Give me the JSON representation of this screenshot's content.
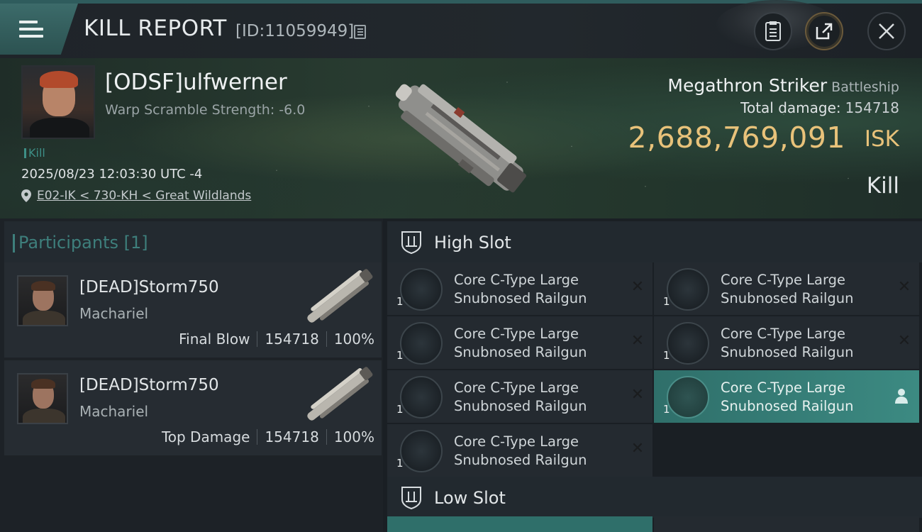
{
  "header": {
    "title": "KILL REPORT",
    "report_id": "[ID:11059949]"
  },
  "victim": {
    "name": "[ODSF]ulfwerner",
    "warp_scramble": "Warp Scramble Strength: -6.0",
    "tag": "Kill",
    "timestamp": "2025/08/23 12:03:30 UTC -4",
    "location": "E02-IK < 730-KH < Great Wildlands",
    "ship_name": "Megathron Striker",
    "ship_class": "Battleship",
    "total_damage_label": "Total damage:",
    "total_damage": "154718",
    "isk_value": "2,688,769,091",
    "isk_unit": "ISK",
    "result": "Kill"
  },
  "participants": {
    "title": "Participants [1]",
    "rows": [
      {
        "name": "[DEAD]Storm750",
        "ship": "Machariel",
        "role": "Final Blow",
        "damage": "154718",
        "percent": "100%"
      },
      {
        "name": "[DEAD]Storm750",
        "ship": "Machariel",
        "role": "Top Damage",
        "damage": "154718",
        "percent": "100%"
      }
    ]
  },
  "high_slot": {
    "title": "High Slot",
    "modules": [
      {
        "line1": "Core C-Type Large",
        "line2": "Snubnosed Railgun",
        "qty": "1",
        "status": "destroyed"
      },
      {
        "line1": "Core C-Type Large",
        "line2": "Snubnosed Railgun",
        "qty": "1",
        "status": "destroyed"
      },
      {
        "line1": "Core C-Type Large",
        "line2": "Snubnosed Railgun",
        "qty": "1",
        "status": "destroyed"
      },
      {
        "line1": "Core C-Type Large",
        "line2": "Snubnosed Railgun",
        "qty": "1",
        "status": "destroyed"
      },
      {
        "line1": "Core C-Type Large",
        "line2": "Snubnosed Railgun",
        "qty": "1",
        "status": "destroyed"
      },
      {
        "line1": "Core C-Type Large",
        "line2": "Snubnosed Railgun",
        "qty": "1",
        "status": "dropped"
      },
      {
        "line1": "Core C-Type Large",
        "line2": "Snubnosed Railgun",
        "qty": "1",
        "status": "destroyed"
      }
    ]
  },
  "low_slot": {
    "title": "Low Slot"
  },
  "colors": {
    "accent_teal": "#3e7f7c",
    "isk_gold": "#e8c27a",
    "active_row": "#3c8a82"
  }
}
